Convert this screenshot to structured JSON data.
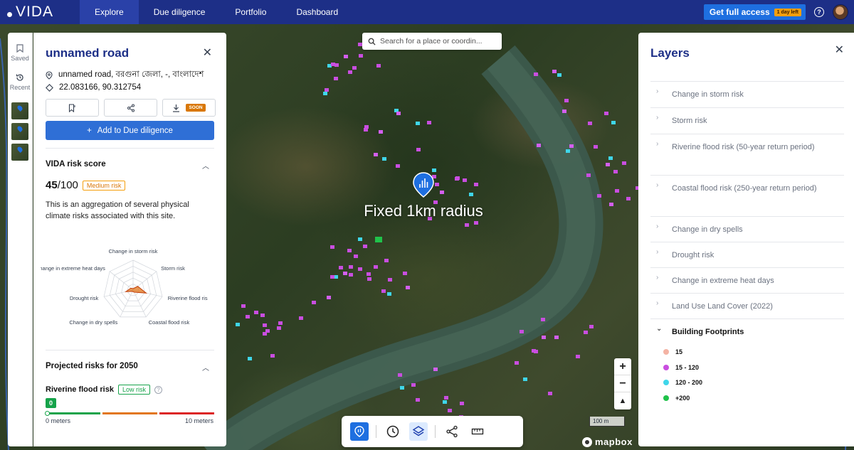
{
  "brand": {
    "name": "VIDA"
  },
  "nav": {
    "tabs": [
      "Explore",
      "Due diligence",
      "Portfolio",
      "Dashboard"
    ],
    "cta_label": "Get full access",
    "cta_badge": "1 day left",
    "help": "?"
  },
  "rail": {
    "saved_label": "Saved",
    "recent_label": "Recent"
  },
  "site": {
    "title": "unnamed road",
    "address": "unnamed road, বরগুনা জেলা, -, বাংলাদেশ",
    "coordinates": "22.083166, 90.312754",
    "download_badge": "SOON",
    "add_button": "Add to Due diligence"
  },
  "risk": {
    "section_title": "VIDA risk score",
    "score": "45",
    "max": "/100",
    "level": "Medium risk",
    "description": "This is an aggregation of several physical climate risks associated with this site.",
    "radar_axes": [
      "Change in storm risk",
      "Storm risk",
      "Riverine flood ris",
      "Coastal flood risk",
      "Change in dry spells",
      "Drought risk",
      "Change in extreme heat days"
    ],
    "radar_values": [
      0.05,
      0.2,
      0.45,
      0.08,
      0.05,
      0.25,
      0.1
    ]
  },
  "projected": {
    "section_title": "Projected risks for 2050",
    "label": "Riverine flood risk",
    "level": "Low risk",
    "value": "0",
    "min_label": "0 meters",
    "max_label": "10 meters"
  },
  "map": {
    "search_placeholder": "Search for a place or coordin...",
    "radius_label": "Fixed 1km radius",
    "scale_label": "100 m",
    "attribution": "mapbox",
    "zoom_in": "+",
    "zoom_out": "−",
    "compass": "▲"
  },
  "layers": {
    "title": "Layers",
    "items": [
      {
        "name": "Change in storm risk"
      },
      {
        "name": "Storm risk"
      },
      {
        "name": "Riverine flood risk (50-year return period)"
      },
      {
        "name": "Coastal flood risk (250-year return period)"
      },
      {
        "name": "Change in dry spells"
      },
      {
        "name": "Drought risk"
      },
      {
        "name": "Change in extreme heat days"
      },
      {
        "name": "Land Use Land Cover (2022)"
      },
      {
        "name": "Building Footprints"
      }
    ],
    "legend": [
      {
        "label": "15",
        "color": "#f4b3a4"
      },
      {
        "label": "15 - 120",
        "color": "#c94ee0"
      },
      {
        "label": "120 - 200",
        "color": "#3fd6ea"
      },
      {
        "label": "+200",
        "color": "#20c24a"
      }
    ]
  },
  "colors": {
    "nav": "#1d2f87",
    "accent": "#1e6fe0",
    "title": "#1d2f87",
    "medium": "#d97706",
    "low": "#16a34a"
  }
}
